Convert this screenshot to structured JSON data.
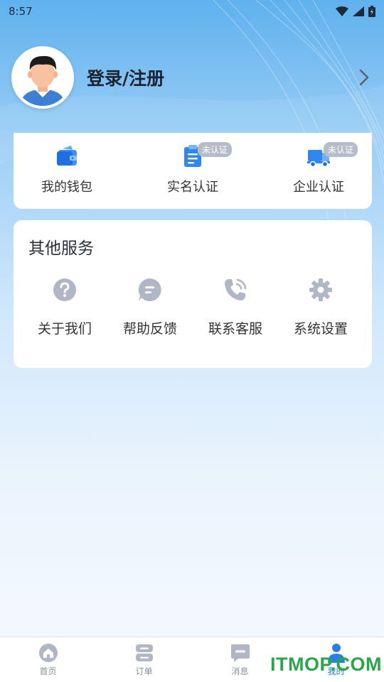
{
  "status_bar": {
    "time": "8:57"
  },
  "profile": {
    "login_label": "登录/注册"
  },
  "quick_actions": [
    {
      "label": "我的钱包",
      "icon": "wallet-icon",
      "badge": ""
    },
    {
      "label": "实名认证",
      "icon": "id-document-icon",
      "badge": "未认证"
    },
    {
      "label": "企业认证",
      "icon": "truck-icon",
      "badge": "未认证"
    }
  ],
  "services": {
    "title": "其他服务",
    "items": [
      {
        "label": "关于我们",
        "icon": "question-icon"
      },
      {
        "label": "帮助反馈",
        "icon": "feedback-icon"
      },
      {
        "label": "联系客服",
        "icon": "phone-icon"
      },
      {
        "label": "系统设置",
        "icon": "gear-icon"
      }
    ]
  },
  "bottom_nav": [
    {
      "label": "首页",
      "icon": "home-icon",
      "active": false
    },
    {
      "label": "订单",
      "icon": "orders-icon",
      "active": false
    },
    {
      "label": "消息",
      "icon": "message-icon",
      "active": false
    },
    {
      "label": "我的",
      "icon": "profile-icon",
      "active": true
    }
  ],
  "watermark": "ITMOP.COM",
  "colors": {
    "accent": "#2a7fe6",
    "icon_gray": "#b0b6c3",
    "badge": "#b7bdc8",
    "watermark": "#2aa64a"
  }
}
